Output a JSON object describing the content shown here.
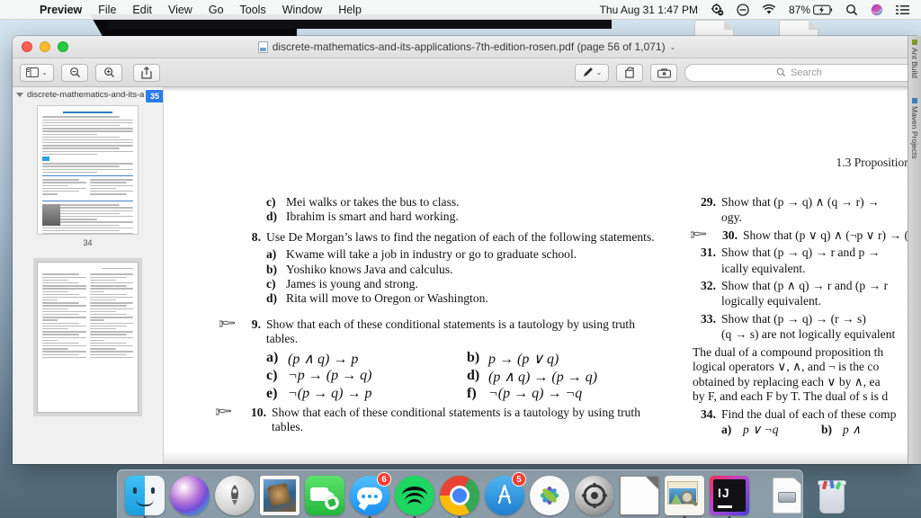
{
  "menubar": {
    "apple_icon": "apple-logo-icon",
    "items": [
      {
        "label": "Preview",
        "bold": true
      },
      {
        "label": "File",
        "bold": false
      },
      {
        "label": "Edit",
        "bold": false
      },
      {
        "label": "View",
        "bold": false
      },
      {
        "label": "Go",
        "bold": false
      },
      {
        "label": "Tools",
        "bold": false
      },
      {
        "label": "Window",
        "bold": false
      },
      {
        "label": "Help",
        "bold": false
      }
    ],
    "status": {
      "battery_percent": "87%",
      "datetime": "Thu Aug 31  1:47 PM",
      "icons": [
        "gear-process-icon",
        "do-not-disturb-icon",
        "wifi-icon",
        "battery-charging-icon",
        "spotlight-search-icon",
        "siri-icon",
        "notification-center-icon"
      ]
    }
  },
  "window": {
    "title": "discrete-mathematics-and-its-applications-7th-edition-rosen.pdf (page 56 of 1,071)",
    "title_chevron": "⌄",
    "traffic_lights": [
      "close-button",
      "minimize-button",
      "zoom-button"
    ],
    "toolbar": {
      "sidebar_toggle": "sidebar-toggle-icon",
      "sidebar_chevron": "⌄",
      "zoom_out": "zoom-out-icon",
      "zoom_in": "zoom-in-icon",
      "share": "share-icon",
      "markup": "markup-pen-icon",
      "markup_chevron": "⌄",
      "rotate": "rotate-icon",
      "toolbox": "markup-toolbox-icon",
      "search_placeholder": "Search"
    }
  },
  "sidebar": {
    "header_label": "discrete-mathematics-and-its-ap...",
    "thumbnails": [
      {
        "page_label": "34",
        "selected": false
      },
      {
        "page_label": "35",
        "selected": true
      }
    ]
  },
  "document": {
    "running_head": "1.3 Proposition",
    "left_column": [
      {
        "type": "sub",
        "letter": "c)",
        "text": "Mei walks or takes the bus to class."
      },
      {
        "type": "sub",
        "letter": "d)",
        "text": "Ibrahim is smart and hard working."
      },
      {
        "type": "exercise",
        "number": "8.",
        "hand": false,
        "text": "Use De Morgan’s laws to find the negation of each of the following statements.",
        "subs": [
          {
            "letter": "a)",
            "text": "Kwame will take a job in industry or go to graduate school."
          },
          {
            "letter": "b)",
            "text": "Yoshiko knows Java and calculus."
          },
          {
            "letter": "c)",
            "text": "James is young and strong."
          },
          {
            "letter": "d)",
            "text": "Rita will move to Oregon or Washington."
          }
        ]
      },
      {
        "type": "exercise",
        "number": "9.",
        "hand": true,
        "text": "Show that each of these conditional statements is a tautology by using truth tables.",
        "grid": [
          {
            "letter": "a)",
            "text": "(p ∧ q) → p"
          },
          {
            "letter": "b)",
            "text": "p → (p ∨ q)"
          },
          {
            "letter": "c)",
            "text": "¬p → (p → q)"
          },
          {
            "letter": "d)",
            "text": "(p ∧ q) → (p → q)"
          },
          {
            "letter": "e)",
            "text": "¬(p → q) → p"
          },
          {
            "letter": "f)",
            "text": "¬(p → q) → ¬q"
          }
        ]
      },
      {
        "type": "exercise",
        "number": "10.",
        "hand": true,
        "text": "Show that each of these conditional statements is a tautology by using truth tables.",
        "subs": []
      }
    ],
    "right_column": [
      {
        "type": "exercise",
        "number": "29.",
        "hand": false,
        "text": "Show that (p → q) ∧ (q → r) → ",
        "cont": "ogy."
      },
      {
        "type": "exercise",
        "number": "30.",
        "hand": true,
        "text": "Show that (p ∨ q) ∧ (¬p ∨ r) → (q"
      },
      {
        "type": "exercise",
        "number": "31.",
        "hand": false,
        "text": "Show that (p → q) → r and p → ",
        "cont": "ically equivalent."
      },
      {
        "type": "exercise",
        "number": "32.",
        "hand": false,
        "text": "Show that (p ∧ q) → r and (p → r",
        "cont": "logically equivalent."
      },
      {
        "type": "exercise",
        "number": "33.",
        "hand": false,
        "text": "Show      that      (p → q) → (r → s)",
        "cont": "(q → s) are not logically equivalent"
      },
      {
        "type": "paragraph",
        "lines": [
          "The dual of a compound proposition th",
          "logical operators ∨, ∧, and ¬ is the co",
          "obtained by replacing each ∨ by ∧, ea",
          "by F, and each F by T. The dual of s is d"
        ]
      },
      {
        "type": "exercise",
        "number": "34.",
        "hand": false,
        "text": "Find the dual of each of these comp"
      },
      {
        "type": "grid_partial",
        "items": [
          {
            "letter": "a)",
            "text": "p ∨ ¬q"
          },
          {
            "letter": "b)",
            "text": "p ∧ "
          }
        ]
      }
    ]
  },
  "ide_strip": {
    "tabs": [
      "Ant Build",
      "Maven Projects"
    ]
  },
  "dock": {
    "items": [
      {
        "name": "finder",
        "running": true,
        "badge": null
      },
      {
        "name": "siri",
        "running": false,
        "badge": null
      },
      {
        "name": "launchpad",
        "running": false,
        "badge": null
      },
      {
        "name": "mail",
        "running": false,
        "badge": null
      },
      {
        "name": "facetime",
        "running": false,
        "badge": null
      },
      {
        "name": "messages",
        "running": true,
        "badge": "6"
      },
      {
        "name": "spotify",
        "running": true,
        "badge": null
      },
      {
        "name": "chrome",
        "running": true,
        "badge": null
      },
      {
        "name": "app-store",
        "running": false,
        "badge": "5"
      },
      {
        "name": "photos",
        "running": false,
        "badge": null
      },
      {
        "name": "system-preferences",
        "running": false,
        "badge": null
      },
      {
        "name": "libreoffice",
        "running": false,
        "badge": null
      },
      {
        "name": "preview",
        "running": true,
        "badge": null
      },
      {
        "name": "intellij-idea",
        "running": true,
        "badge": null
      },
      {
        "name": "separator",
        "running": false,
        "badge": null
      },
      {
        "name": "document-file",
        "running": false,
        "badge": null
      },
      {
        "name": "trash",
        "running": false,
        "badge": null
      }
    ]
  }
}
